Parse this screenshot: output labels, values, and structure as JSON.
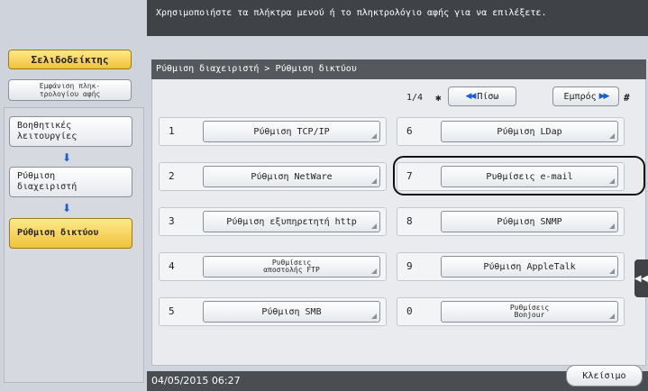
{
  "header": {
    "message": "Χρησιμοποιήστε τα πλήκτρα μενού ή το πληκτρολόγιο αφής για να επιλέξετε."
  },
  "left_panel": {
    "bookmark_label": "Σελιδοδείκτης",
    "keypad_label_line1": "Εμφάνιση πληκ-",
    "keypad_label_line2": "τρολογίου αφής",
    "nav_items": [
      {
        "label": "Βοηθητικές λειτουργίες"
      },
      {
        "label": "Ρύθμιση διαχειριστή"
      },
      {
        "label": "Ρύθμιση δικτύου"
      }
    ]
  },
  "main": {
    "breadcrumb": "Ρύθμιση διαχειριστή > Ρύθμιση δικτύου",
    "pager": {
      "count": "1/4",
      "star": "✱",
      "prev_label": "Πίσω",
      "next_label": "Εμπρός",
      "hash": "#"
    },
    "options": [
      {
        "num": "1",
        "label": "Ρύθμιση TCP/IP"
      },
      {
        "num": "2",
        "label": "Ρύθμιση NetWare"
      },
      {
        "num": "3",
        "label": "Ρύθμιση εξυπηρετητή http"
      },
      {
        "num": "4",
        "label": "Ρυθμίσεις αποστολής FTP"
      },
      {
        "num": "5",
        "label": "Ρύθμιση SMB"
      },
      {
        "num": "6",
        "label": "Ρύθμιση LDap"
      },
      {
        "num": "7",
        "label": "Ρυθμίσεις e-mail"
      },
      {
        "num": "8",
        "label": "Ρύθμιση SNMP"
      },
      {
        "num": "9",
        "label": "Ρύθμιση AppleTalk"
      },
      {
        "num": "0",
        "label": "Ρυθμίσεις Bonjour"
      }
    ],
    "side_tab_glyph": "◀◀"
  },
  "footer": {
    "datetime": "04/05/2015   06:27",
    "close_label": "Κλείσιμο"
  },
  "colors": {
    "accent": "#f0c23a",
    "header_bg": "#3f4247",
    "panel_bg": "#cfd4dc",
    "arrow_blue": "#1a5fd0"
  }
}
